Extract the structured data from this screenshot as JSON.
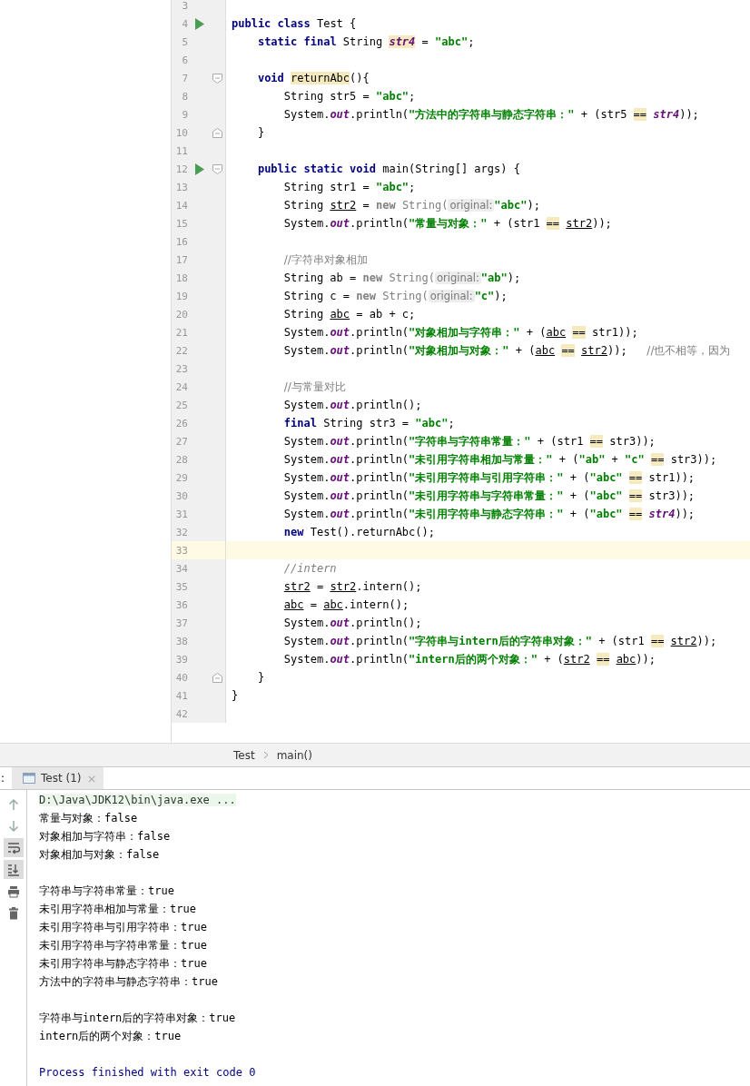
{
  "editor": {
    "lines": [
      {
        "number": "3"
      },
      {
        "number": "4",
        "run": true,
        "segments": [
          {
            "kind": "kw",
            "text": "public class"
          },
          {
            "kind": "p",
            "text": " Test {"
          }
        ]
      },
      {
        "number": "5",
        "segments": [
          {
            "kind": "kw",
            "text": "    static final"
          },
          {
            "kind": "p",
            "text": " String "
          },
          {
            "kind": "hlf",
            "text": "str4"
          },
          {
            "kind": "p",
            "text": " = "
          },
          {
            "kind": "s",
            "text": "\"abc\""
          },
          {
            "kind": "p",
            "text": ";"
          }
        ]
      },
      {
        "number": "6"
      },
      {
        "number": "7",
        "fold": {
          "kind": "start"
        },
        "segments": [
          {
            "kind": "kw",
            "text": "    void "
          },
          {
            "kind": "hl",
            "text": "returnAbc"
          },
          {
            "kind": "p",
            "text": "(){"
          }
        ]
      },
      {
        "number": "8",
        "segments": [
          {
            "kind": "p",
            "text": "        String str5 = "
          },
          {
            "kind": "s",
            "text": "\"abc\""
          },
          {
            "kind": "p",
            "text": ";"
          }
        ]
      },
      {
        "number": "9",
        "segments": [
          {
            "kind": "p",
            "text": "        System."
          },
          {
            "kind": "f",
            "text": "out"
          },
          {
            "kind": "p",
            "text": ".println("
          },
          {
            "kind": "s",
            "text": "\"方法中的字符串与静态字符串：\""
          },
          {
            "kind": "p",
            "text": " + (str5 "
          },
          {
            "kind": "hl",
            "text": "=="
          },
          {
            "kind": "f",
            "text": " str4"
          },
          {
            "kind": "p",
            "text": "));"
          }
        ]
      },
      {
        "number": "10",
        "fold": {
          "kind": "end"
        },
        "segments": [
          {
            "kind": "p",
            "text": "    }"
          }
        ]
      },
      {
        "number": "11"
      },
      {
        "number": "12",
        "run": true,
        "fold": {
          "kind": "start"
        },
        "segments": [
          {
            "kind": "kw",
            "text": "    public static void"
          },
          {
            "kind": "p",
            "text": " main(String[] args) {"
          }
        ]
      },
      {
        "number": "13",
        "segments": [
          {
            "kind": "p",
            "text": "        String str1 = "
          },
          {
            "kind": "s",
            "text": "\"abc\""
          },
          {
            "kind": "p",
            "text": ";"
          }
        ]
      },
      {
        "number": "14",
        "segments": [
          {
            "kind": "p",
            "text": "        String "
          },
          {
            "kind": "u",
            "text": "str2"
          },
          {
            "kind": "p",
            "text": " = "
          },
          {
            "kind": "g",
            "text": "new"
          },
          {
            "kind": "gp",
            "text": " String("
          },
          {
            "kind": "h",
            "text": "original:"
          },
          {
            "kind": "s",
            "text": "\"abc\""
          },
          {
            "kind": "p",
            "text": ");"
          }
        ]
      },
      {
        "number": "15",
        "segments": [
          {
            "kind": "p",
            "text": "        System."
          },
          {
            "kind": "f",
            "text": "out"
          },
          {
            "kind": "p",
            "text": ".println("
          },
          {
            "kind": "s",
            "text": "\"常量与对象：\""
          },
          {
            "kind": "p",
            "text": " + (str1 "
          },
          {
            "kind": "hl",
            "text": "=="
          },
          {
            "kind": "u",
            "text": " str2"
          },
          {
            "kind": "p",
            "text": "));"
          }
        ]
      },
      {
        "number": "16"
      },
      {
        "number": "17",
        "segments": [
          {
            "kind": "c",
            "text": "        //字符串对象相加"
          }
        ]
      },
      {
        "number": "18",
        "segments": [
          {
            "kind": "p",
            "text": "        String ab = "
          },
          {
            "kind": "g",
            "text": "new"
          },
          {
            "kind": "gp",
            "text": " String("
          },
          {
            "kind": "h",
            "text": "original:"
          },
          {
            "kind": "s",
            "text": "\"ab\""
          },
          {
            "kind": "p",
            "text": ");"
          }
        ]
      },
      {
        "number": "19",
        "segments": [
          {
            "kind": "p",
            "text": "        String c = "
          },
          {
            "kind": "g",
            "text": "new"
          },
          {
            "kind": "gp",
            "text": " String("
          },
          {
            "kind": "h",
            "text": "original:"
          },
          {
            "kind": "s",
            "text": "\"c\""
          },
          {
            "kind": "p",
            "text": ");"
          }
        ]
      },
      {
        "number": "20",
        "segments": [
          {
            "kind": "p",
            "text": "        String "
          },
          {
            "kind": "u",
            "text": "abc"
          },
          {
            "kind": "p",
            "text": " = ab + c;"
          }
        ]
      },
      {
        "number": "21",
        "segments": [
          {
            "kind": "p",
            "text": "        System."
          },
          {
            "kind": "f",
            "text": "out"
          },
          {
            "kind": "p",
            "text": ".println("
          },
          {
            "kind": "s",
            "text": "\"对象相加与字符串：\""
          },
          {
            "kind": "p",
            "text": " + ("
          },
          {
            "kind": "u",
            "text": "abc"
          },
          {
            "kind": "hl",
            "text": " =="
          },
          {
            "kind": "p",
            "text": " str1));"
          }
        ]
      },
      {
        "number": "22",
        "segments": [
          {
            "kind": "p",
            "text": "        System."
          },
          {
            "kind": "f",
            "text": "out"
          },
          {
            "kind": "p",
            "text": ".println("
          },
          {
            "kind": "s",
            "text": "\"对象相加与对象：\""
          },
          {
            "kind": "p",
            "text": " + ("
          },
          {
            "kind": "u",
            "text": "abc"
          },
          {
            "kind": "hl",
            "text": " =="
          },
          {
            "kind": "u",
            "text": " str2"
          },
          {
            "kind": "p",
            "text": "));"
          },
          {
            "kind": "c",
            "text": "   //也不相等，因为"
          }
        ]
      },
      {
        "number": "23"
      },
      {
        "number": "24",
        "segments": [
          {
            "kind": "c",
            "text": "        //与常量对比"
          }
        ]
      },
      {
        "number": "25",
        "segments": [
          {
            "kind": "p",
            "text": "        System."
          },
          {
            "kind": "f",
            "text": "out"
          },
          {
            "kind": "p",
            "text": ".println();"
          }
        ]
      },
      {
        "number": "26",
        "segments": [
          {
            "kind": "kw",
            "text": "        final"
          },
          {
            "kind": "p",
            "text": " String str3 = "
          },
          {
            "kind": "s",
            "text": "\"abc\""
          },
          {
            "kind": "p",
            "text": ";"
          }
        ]
      },
      {
        "number": "27",
        "segments": [
          {
            "kind": "p",
            "text": "        System."
          },
          {
            "kind": "f",
            "text": "out"
          },
          {
            "kind": "p",
            "text": ".println("
          },
          {
            "kind": "s",
            "text": "\"字符串与字符串常量：\""
          },
          {
            "kind": "p",
            "text": " + (str1 "
          },
          {
            "kind": "hl",
            "text": "=="
          },
          {
            "kind": "p",
            "text": " str3));"
          }
        ]
      },
      {
        "number": "28",
        "segments": [
          {
            "kind": "p",
            "text": "        System."
          },
          {
            "kind": "f",
            "text": "out"
          },
          {
            "kind": "p",
            "text": ".println("
          },
          {
            "kind": "s",
            "text": "\"未引用字符串相加与常量：\""
          },
          {
            "kind": "p",
            "text": " + ("
          },
          {
            "kind": "s",
            "text": "\"ab\""
          },
          {
            "kind": "p",
            "text": " + "
          },
          {
            "kind": "s",
            "text": "\"c\""
          },
          {
            "kind": "hl",
            "text": " =="
          },
          {
            "kind": "p",
            "text": " str3));"
          }
        ]
      },
      {
        "number": "29",
        "segments": [
          {
            "kind": "p",
            "text": "        System."
          },
          {
            "kind": "f",
            "text": "out"
          },
          {
            "kind": "p",
            "text": ".println("
          },
          {
            "kind": "s",
            "text": "\"未引用字符串与引用字符串：\""
          },
          {
            "kind": "p",
            "text": " + ("
          },
          {
            "kind": "s",
            "text": "\"abc\""
          },
          {
            "kind": "hl",
            "text": " =="
          },
          {
            "kind": "p",
            "text": " str1));"
          }
        ]
      },
      {
        "number": "30",
        "segments": [
          {
            "kind": "p",
            "text": "        System."
          },
          {
            "kind": "f",
            "text": "out"
          },
          {
            "kind": "p",
            "text": ".println("
          },
          {
            "kind": "s",
            "text": "\"未引用字符串与字符串常量：\""
          },
          {
            "kind": "p",
            "text": " + ("
          },
          {
            "kind": "s",
            "text": "\"abc\""
          },
          {
            "kind": "hl",
            "text": " =="
          },
          {
            "kind": "p",
            "text": " str3));"
          }
        ]
      },
      {
        "number": "31",
        "segments": [
          {
            "kind": "p",
            "text": "        System."
          },
          {
            "kind": "f",
            "text": "out"
          },
          {
            "kind": "p",
            "text": ".println("
          },
          {
            "kind": "s",
            "text": "\"未引用字符串与静态字符串：\""
          },
          {
            "kind": "p",
            "text": " + ("
          },
          {
            "kind": "s",
            "text": "\"abc\""
          },
          {
            "kind": "hl",
            "text": " =="
          },
          {
            "kind": "f",
            "text": " str4"
          },
          {
            "kind": "p",
            "text": "));"
          }
        ]
      },
      {
        "number": "32",
        "segments": [
          {
            "kind": "kw",
            "text": "        new"
          },
          {
            "kind": "p",
            "text": " Test().returnAbc();"
          }
        ]
      },
      {
        "number": "33",
        "current": true
      },
      {
        "number": "34",
        "segments": [
          {
            "kind": "ci",
            "text": "        //intern"
          }
        ]
      },
      {
        "number": "35",
        "segments": [
          {
            "kind": "u",
            "text": "        str2"
          },
          {
            "kind": "p",
            "text": " = "
          },
          {
            "kind": "u",
            "text": "str2"
          },
          {
            "kind": "p",
            "text": ".intern();"
          }
        ]
      },
      {
        "number": "36",
        "segments": [
          {
            "kind": "u",
            "text": "        abc"
          },
          {
            "kind": "p",
            "text": " = "
          },
          {
            "kind": "u",
            "text": "abc"
          },
          {
            "kind": "p",
            "text": ".intern();"
          }
        ]
      },
      {
        "number": "37",
        "segments": [
          {
            "kind": "p",
            "text": "        System."
          },
          {
            "kind": "f",
            "text": "out"
          },
          {
            "kind": "p",
            "text": ".println();"
          }
        ]
      },
      {
        "number": "38",
        "segments": [
          {
            "kind": "p",
            "text": "        System."
          },
          {
            "kind": "f",
            "text": "out"
          },
          {
            "kind": "p",
            "text": ".println("
          },
          {
            "kind": "s",
            "text": "\"字符串与intern后的字符串对象：\""
          },
          {
            "kind": "p",
            "text": " + (str1 "
          },
          {
            "kind": "hl",
            "text": "=="
          },
          {
            "kind": "u",
            "text": " str2"
          },
          {
            "kind": "p",
            "text": "));"
          }
        ]
      },
      {
        "number": "39",
        "segments": [
          {
            "kind": "p",
            "text": "        System."
          },
          {
            "kind": "f",
            "text": "out"
          },
          {
            "kind": "p",
            "text": ".println("
          },
          {
            "kind": "s",
            "text": "\"intern后的两个对象：\""
          },
          {
            "kind": "p",
            "text": " + ("
          },
          {
            "kind": "u",
            "text": "str2"
          },
          {
            "kind": "hl",
            "text": " =="
          },
          {
            "kind": "u",
            "text": " abc"
          },
          {
            "kind": "p",
            "text": "));"
          }
        ]
      },
      {
        "number": "40",
        "fold": {
          "kind": "end"
        },
        "segments": [
          {
            "kind": "p",
            "text": "    }"
          }
        ]
      },
      {
        "number": "41",
        "segments": [
          {
            "kind": "p",
            "text": "}"
          }
        ]
      },
      {
        "number": "42"
      }
    ]
  },
  "breadcrumbs": [
    "Test",
    "main()"
  ],
  "run_panel": {
    "edge_label": ":",
    "tab": {
      "label": "Test (1)",
      "close": "×"
    },
    "toolbar": [
      {
        "kind": "up",
        "on": false
      },
      {
        "kind": "down",
        "on": false
      },
      {
        "kind": "wrap",
        "on": true
      },
      {
        "kind": "scroll",
        "on": true
      },
      {
        "kind": "print",
        "on": false
      },
      {
        "kind": "trash",
        "on": false
      }
    ],
    "console": [
      {
        "kind": "command",
        "text": "D:\\Java\\JDK12\\bin\\java.exe ..."
      },
      {
        "kind": "output",
        "text": "常量与对象：false"
      },
      {
        "kind": "output",
        "text": "对象相加与字符串：false"
      },
      {
        "kind": "output",
        "text": "对象相加与对象：false"
      },
      {
        "kind": "blank"
      },
      {
        "kind": "output",
        "text": "字符串与字符串常量：true"
      },
      {
        "kind": "output",
        "text": "未引用字符串相加与常量：true"
      },
      {
        "kind": "output",
        "text": "未引用字符串与引用字符串：true"
      },
      {
        "kind": "output",
        "text": "未引用字符串与字符串常量：true"
      },
      {
        "kind": "output",
        "text": "未引用字符串与静态字符串：true"
      },
      {
        "kind": "output",
        "text": "方法中的字符串与静态字符串：true"
      },
      {
        "kind": "blank"
      },
      {
        "kind": "output",
        "text": "字符串与intern后的字符串对象：true"
      },
      {
        "kind": "output",
        "text": "intern后的两个对象：true"
      },
      {
        "kind": "blank"
      },
      {
        "kind": "exit",
        "text": "Process finished with exit code 0"
      }
    ]
  }
}
